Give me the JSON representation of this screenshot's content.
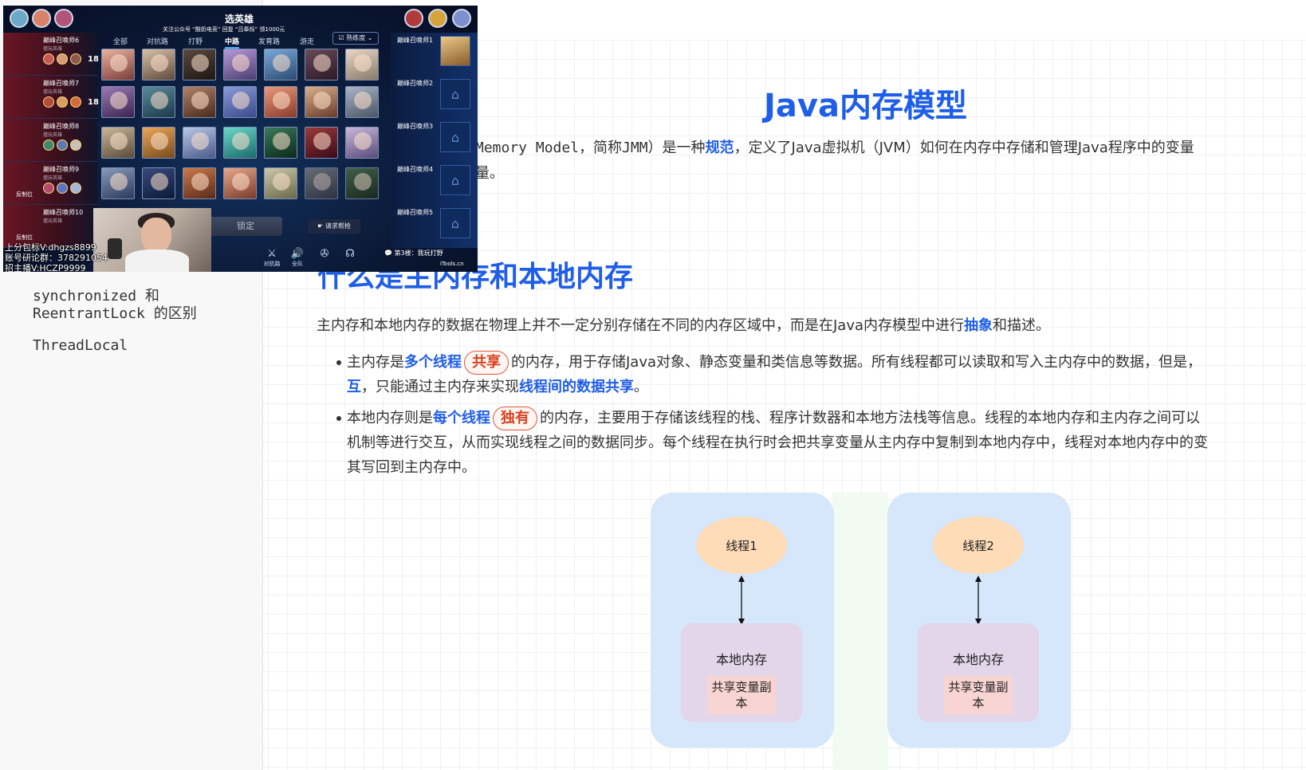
{
  "sidebar": {
    "items": [
      {
        "line1": "synchronized 和",
        "line2": "ReentrantLock 的区别"
      },
      {
        "line1": "ThreadLocal"
      }
    ]
  },
  "document": {
    "title": "Java内存模型",
    "intro": {
      "prefix": "Memory Model，简称JMM）是一种",
      "keyword": "规范",
      "suffix": "，定义了Java虚拟机（JVM）如何在内存中存储和管理Java程序中的变量",
      "line2": "量。"
    },
    "section_heading": "什么是主内存和本地内存",
    "section_para": {
      "prefix": "主内存和本地内存的数据在物理上并不一定分别存储在不同的内存区域中，而是在Java内存模型中进行",
      "keyword": "抽象",
      "suffix": "和描述。"
    },
    "bullet1": {
      "prefix": "主内存是",
      "kw1": "多个线程",
      "tag": "共享",
      "middle": "的内存，用于存储Java对象、静态变量和类信息等数据。所有线程都可以读取和写入主内存中的数据，但是，",
      "line2_kw": "互",
      "line2_mid": "，只能通过主内存来实现",
      "line2_kw2": "线程间的数据共享",
      "line2_end": "。"
    },
    "bullet2": {
      "prefix": "本地内存则是",
      "kw1": "每个线程",
      "tag": "独有",
      "middle": "的内存，主要用于存储该线程的栈、程序计数器和本地方法栈等信息。线程的本地内存和主内存之间可以",
      "line2": "机制等进行交互，从而实现线程之间的数据同步。每个线程在执行时会把共享变量从主内存中复制到本地内存中，线程对本地内存中的变",
      "line3": "其写回到主内存中。"
    },
    "diagram": {
      "thread1": "线程1",
      "thread2": "线程2",
      "local_memory": "本地内存",
      "copy1": "共享变量副",
      "copy2": "本"
    }
  },
  "game": {
    "title": "选英雄",
    "subtitle": "关注公众号 “酸奶电竞” 回复 “吕奉烁” 领1000元",
    "tabs": [
      "全部",
      "对抗路",
      "打野",
      "中路",
      "发育路",
      "游走"
    ],
    "active_tab": "中路",
    "sort_label": "熟练度",
    "left_players": [
      {
        "name": "巅峰召唤师6",
        "sub": "擅玩英雄",
        "num": "18",
        "label": ""
      },
      {
        "name": "巅峰召唤师7",
        "sub": "擅玩英雄",
        "num": "18",
        "label": ""
      },
      {
        "name": "巅峰召唤师8",
        "sub": "擅玩英雄",
        "num": "",
        "label": ""
      },
      {
        "name": "巅峰召唤师9",
        "sub": "擅玩英雄",
        "num": "",
        "label": "反制位"
      },
      {
        "name": "巅峰召唤师10",
        "sub": "擅玩英雄",
        "num": "",
        "label": "反制位"
      }
    ],
    "right_players": [
      "巅峰召唤师1",
      "巅峰召唤师2",
      "巅峰召唤师3",
      "巅峰召唤师4",
      "巅峰召唤师5"
    ],
    "lock_button": "锁定",
    "help_button": "请求帮抢",
    "bottom_icons": [
      {
        "label": "对抗路",
        "icon": "sword-icon"
      },
      {
        "label": "全队",
        "icon": "speaker-icon"
      },
      {
        "label": "",
        "icon": "mic-icon"
      },
      {
        "label": "",
        "icon": "voice-icon"
      }
    ],
    "chat": "第3楼：我玩打野",
    "watermark": "iTools.cn",
    "overlay_text": [
      "上分包标V:dhgzs8899",
      "账号研论群：378291054",
      "招主播V:HCZP9999"
    ],
    "colors": {
      "enemy": "#6b1624",
      "ally": "#12306a",
      "accent": "#4ab2ff"
    }
  }
}
